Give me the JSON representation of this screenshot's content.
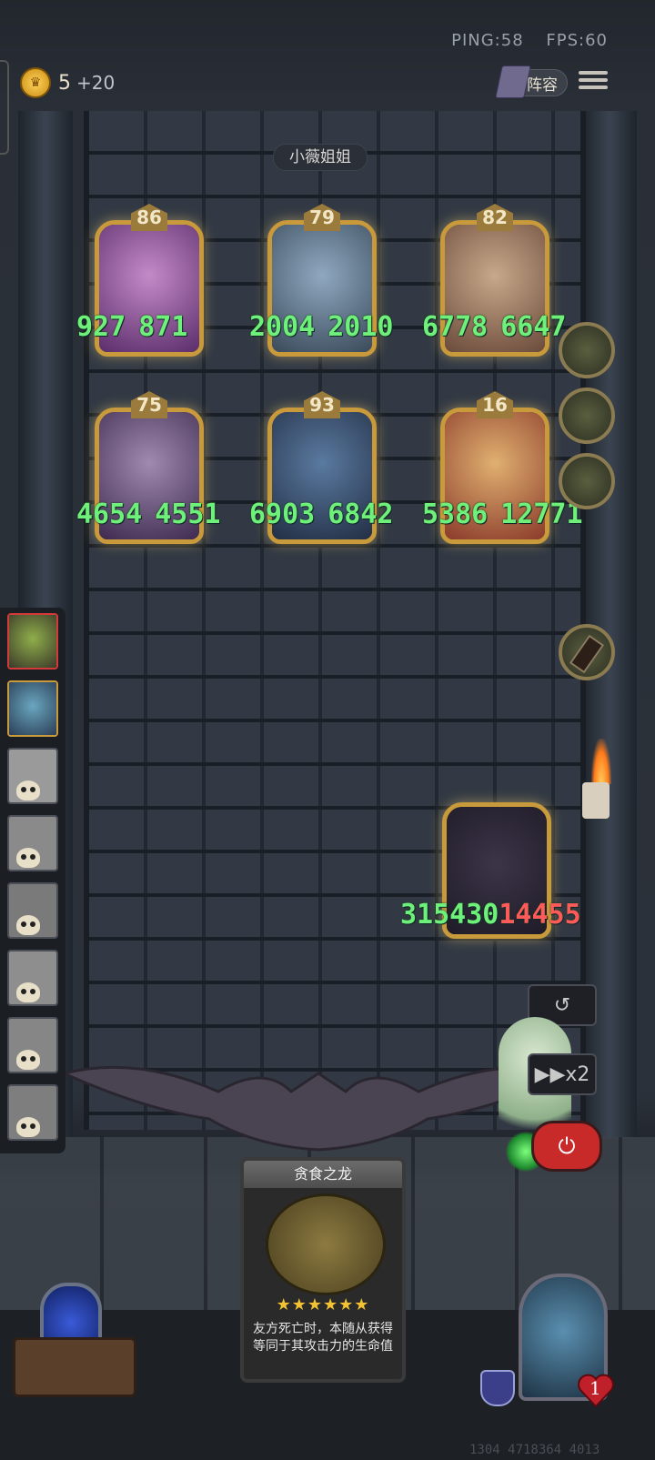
{
  "status": {
    "ping": "PING:58",
    "fps": "FPS:60"
  },
  "currency": {
    "gold": "5",
    "bonus": "+20"
  },
  "header": {
    "lineup_label": "阵容"
  },
  "opponent": {
    "name": "小薇姐姐"
  },
  "enemy_board": [
    {
      "level": "86",
      "attack": "927",
      "health": "871"
    },
    {
      "level": "79",
      "attack": "2004",
      "health": "2010"
    },
    {
      "level": "82",
      "attack": "6778",
      "health": "6647"
    },
    {
      "level": "75",
      "attack": "4654",
      "health": "4551"
    },
    {
      "level": "93",
      "attack": "6903",
      "health": "6842"
    },
    {
      "level": "16",
      "attack": "5386",
      "health": "12771"
    }
  ],
  "player_unit": {
    "attack": "315430",
    "health": "14455"
  },
  "controls": {
    "speed_label": "x2"
  },
  "skill_card": {
    "title": "贪食之龙",
    "stars": "★★★★★★",
    "description": "友方死亡时，本随从获得等同于其攻击力的生命值"
  },
  "hero": {
    "lives": "1"
  },
  "footer": {
    "numbers": "1304 4718364 4013"
  },
  "colors": {
    "stat_green": "#6ef07a",
    "damage_red": "#ff5a5a",
    "gold_frame": "#c99a3b"
  }
}
